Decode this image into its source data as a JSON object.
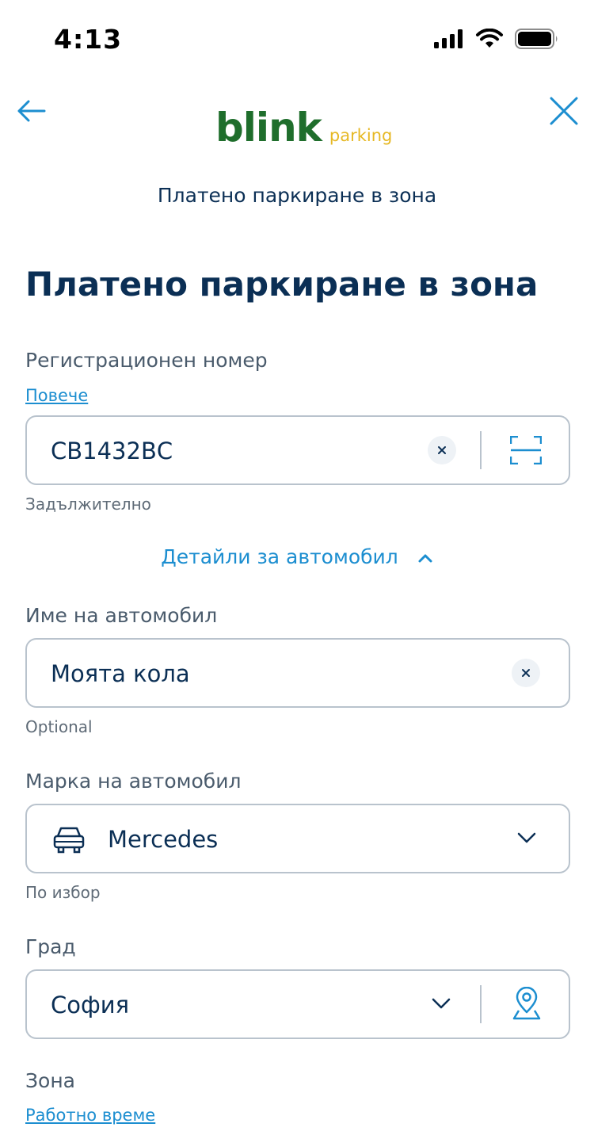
{
  "status_bar": {
    "time": "4:13"
  },
  "nav": {
    "logo_main": "blink",
    "logo_sub": "parking",
    "title": "Платено паркиране в зона"
  },
  "page": {
    "title": "Платено паркиране в зона"
  },
  "registration": {
    "label": "Регистрационен номер",
    "link": "Повече",
    "value": "СВ1432ВС",
    "hint": "Задължително"
  },
  "details_toggle": {
    "label": "Детайли за автомобил"
  },
  "car_name": {
    "label": "Име на автомобил",
    "value": "Моята кола",
    "hint": "Optional"
  },
  "car_brand": {
    "label": "Марка на автомобил",
    "value": "Mercedes",
    "hint": "По избор"
  },
  "city": {
    "label": "Град",
    "value": "София"
  },
  "zone": {
    "label": "Зона",
    "link": "Работно време"
  }
}
